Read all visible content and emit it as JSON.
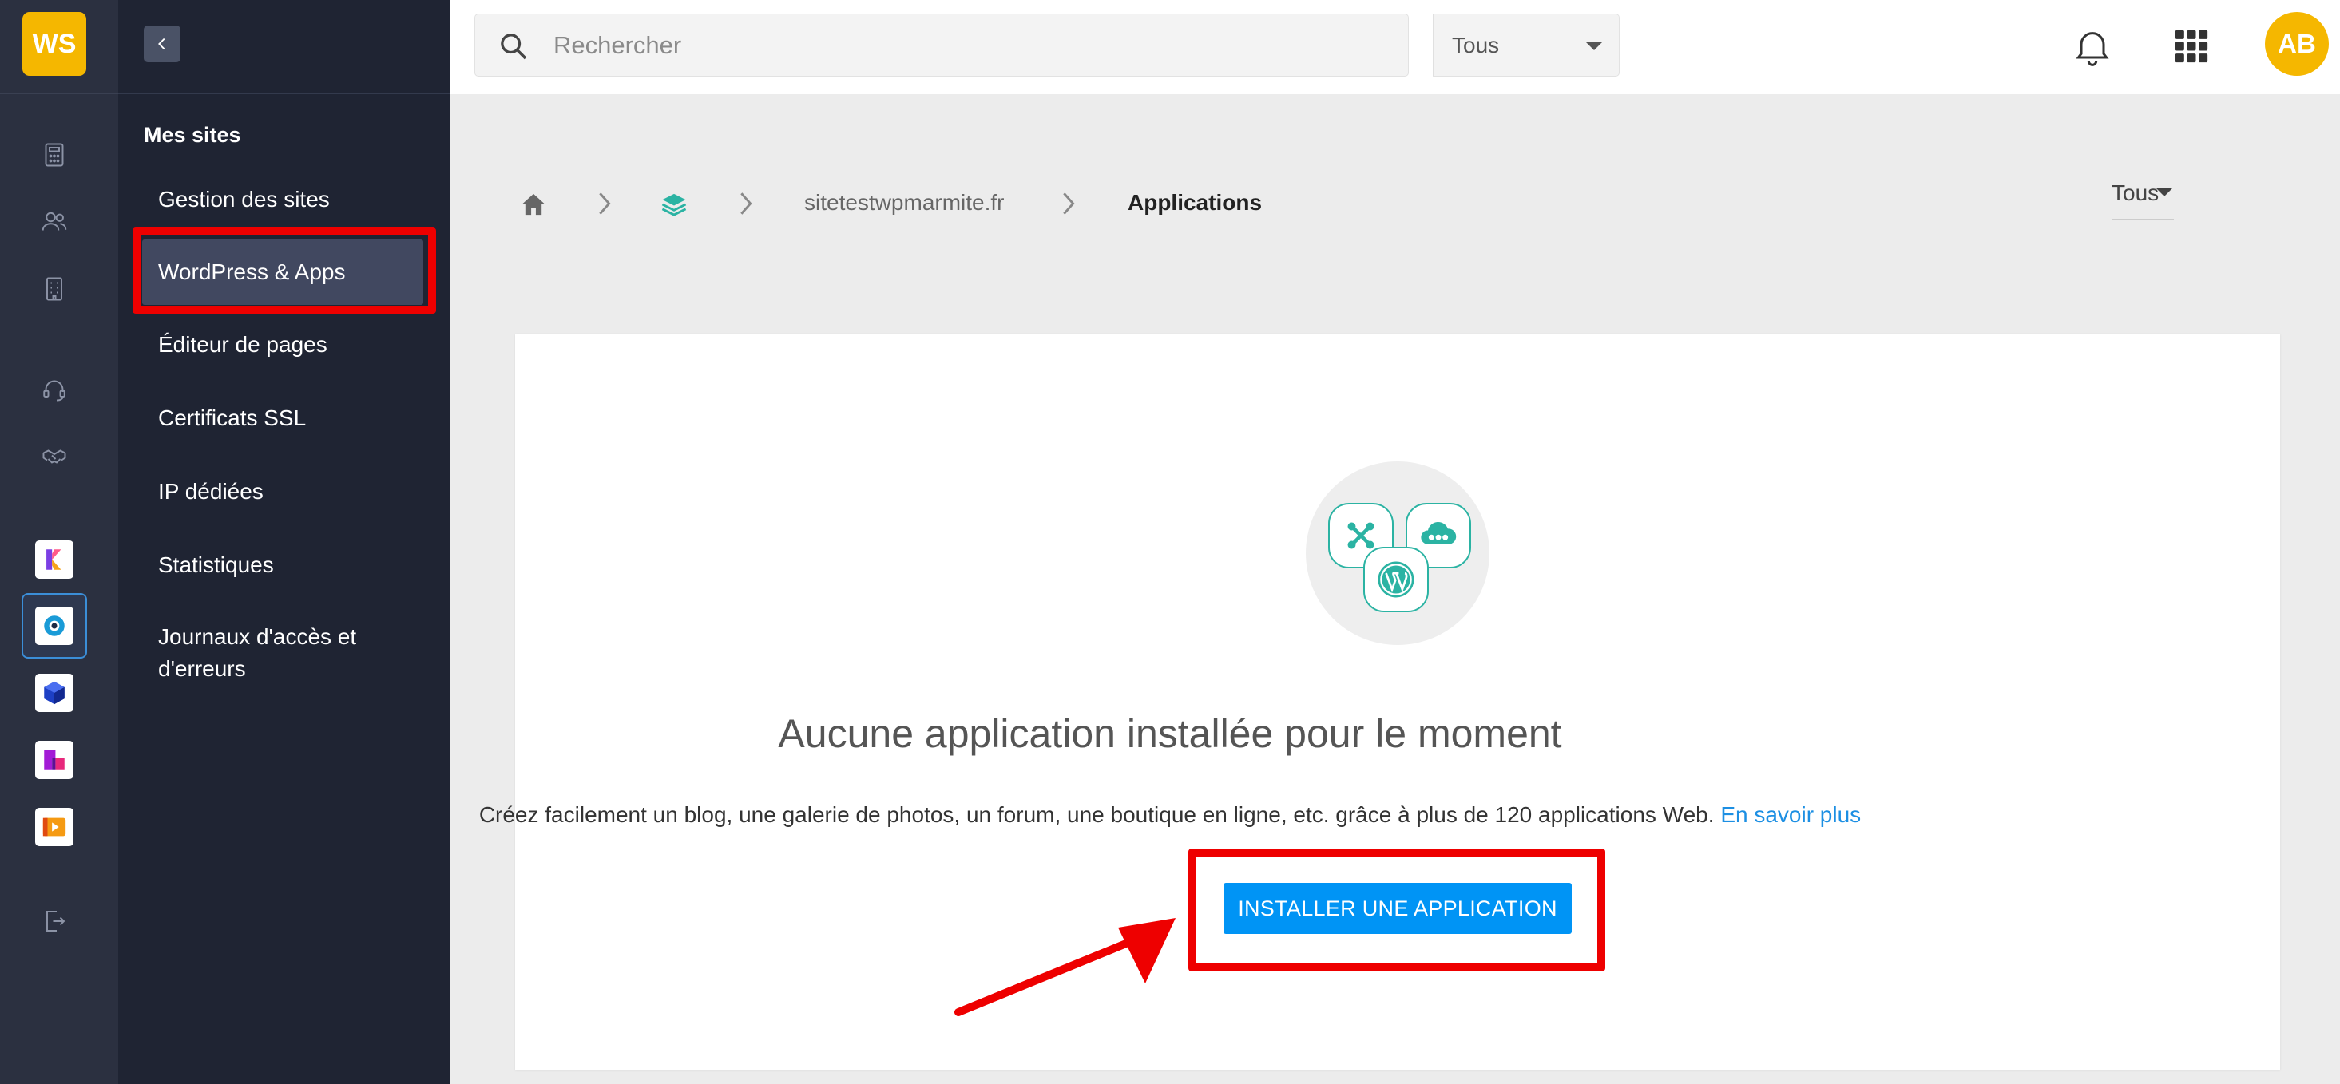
{
  "rail": {
    "logo": "WS",
    "icons": [
      "calculator-icon",
      "users-icon",
      "building-icon",
      "headset-icon",
      "handshake-icon",
      "logout-icon"
    ],
    "apps": [
      "kmail-app-icon",
      "kdrive-app-icon",
      "cube-app-icon",
      "swisstransfer-app-icon",
      "kmeet-app-icon"
    ]
  },
  "sidebar": {
    "section_title": "Mes sites",
    "items": [
      {
        "label": "Gestion des sites"
      },
      {
        "label": "WordPress & Apps"
      },
      {
        "label": "Éditeur de pages"
      },
      {
        "label": "Certificats SSL"
      },
      {
        "label": "IP dédiées"
      },
      {
        "label": "Statistiques"
      },
      {
        "label": "Journaux d'accès et d'erreurs"
      }
    ]
  },
  "topbar": {
    "search_placeholder": "Rechercher",
    "filter_value": "Tous",
    "avatar_initials": "AB"
  },
  "breadcrumb": {
    "site": "sitetestwpmarmite.fr",
    "current": "Applications",
    "select_value": "Tous"
  },
  "empty_state": {
    "title": "Aucune application installée pour le moment",
    "description": "Créez facilement un blog, une galerie de photos, un forum, une boutique en ligne, etc. grâce à plus de 120 applications Web.",
    "link": "En savoir plus",
    "button": "INSTALLER UNE APPLICATION"
  },
  "colors": {
    "brand_yellow": "#f5b700",
    "primary_blue": "#0094f5",
    "link_blue": "#1c8fe3",
    "annotation_red": "#ee0000",
    "teal": "#2bb3a3"
  }
}
